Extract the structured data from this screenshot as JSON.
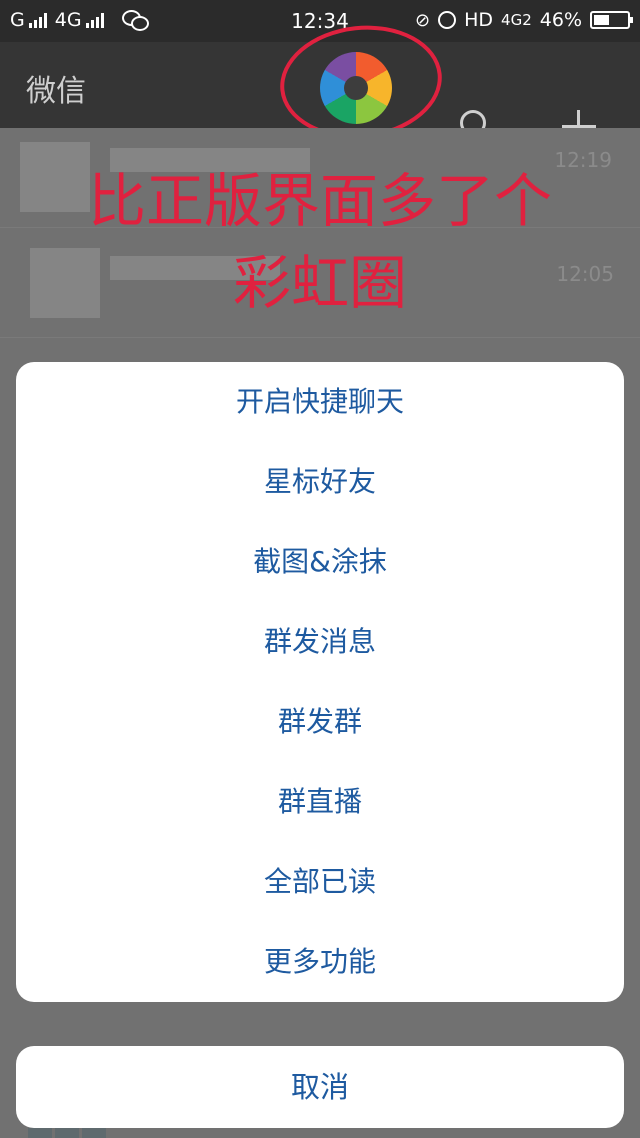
{
  "status_bar": {
    "carrier_prefix": "G",
    "network": "4G",
    "time": "12:34",
    "hd": "HD",
    "net2": "4G2",
    "battery_percent": "46%",
    "battery_level": 0.46,
    "icons": [
      "signal-icon",
      "wechat-icon",
      "mute-icon",
      "alarm-icon",
      "battery-icon"
    ]
  },
  "header": {
    "title": "微信",
    "center_icon": "rainbow-shutter-icon",
    "search_icon": "search-icon",
    "add_icon": "plus-icon"
  },
  "background_list": {
    "times": [
      "12:19",
      "12:05"
    ]
  },
  "annotation": {
    "line1": "比正版界面多了个",
    "line2": "彩虹圈",
    "color": "#e0213f"
  },
  "action_sheet": {
    "items": [
      "开启快捷聊天",
      "星标好友",
      "截图&涂抹",
      "群发消息",
      "群发群",
      "群直播",
      "全部已读",
      "更多功能"
    ],
    "cancel": "取消",
    "text_color": "#1e5aa0"
  }
}
